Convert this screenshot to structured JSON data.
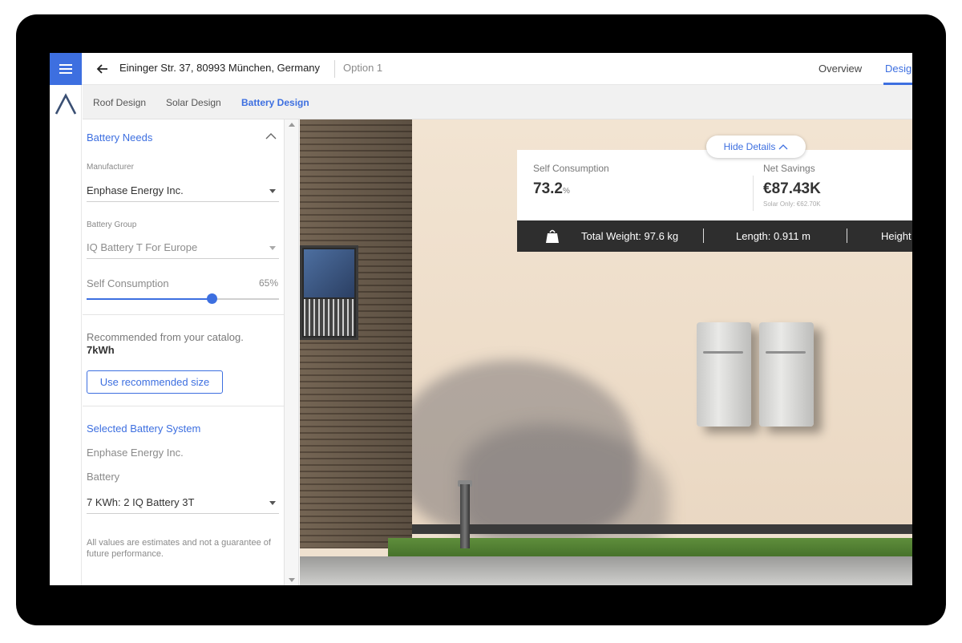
{
  "header": {
    "address": "Eininger Str. 37, 80993 München, Germany",
    "option": "Option 1",
    "tabs": [
      {
        "label": "Overview"
      },
      {
        "label": "Desig"
      }
    ]
  },
  "subtabs": [
    {
      "label": "Roof Design"
    },
    {
      "label": "Solar Design"
    },
    {
      "label": "Battery Design"
    }
  ],
  "panel": {
    "section_title": "Battery Needs",
    "manufacturer_label": "Manufacturer",
    "manufacturer_value": "Enphase Energy Inc.",
    "battery_group_label": "Battery Group",
    "battery_group_value": "IQ Battery T For Europe",
    "self_consumption_label": "Self Consumption",
    "self_consumption_value": "65%",
    "self_consumption_fraction": 0.65,
    "recommended_text": "Recommended from your catalog.",
    "recommended_size": "7kWh",
    "use_recommended_button": "Use recommended size",
    "selected_title": "Selected Battery System",
    "selected_manufacturer": "Enphase Energy Inc.",
    "battery_label": "Battery",
    "battery_value": "7 KWh: 2 IQ Battery 3T",
    "disclaimer": "All values are estimates and not a guarantee of future performance."
  },
  "stats": {
    "hide_details": "Hide Details",
    "self_consumption_label": "Self Consumption",
    "self_consumption_value": "73.2",
    "self_consumption_unit": "%",
    "net_savings_label": "Net Savings",
    "net_savings_value": "€87.43K",
    "solar_only": "Solar Only: €62.70K",
    "total_weight": "Total Weight: 97.6 kg",
    "length": "Length: 0.911 m",
    "height": "Height"
  },
  "colors": {
    "accent": "#3d6fe0",
    "dark_bar": "#2e2e2e"
  },
  "icons": {
    "menu": "menu-icon",
    "back": "arrow-left-icon",
    "logo": "logo-icon",
    "collapse": "chevron-up-icon",
    "weight": "weight-bag-icon"
  }
}
